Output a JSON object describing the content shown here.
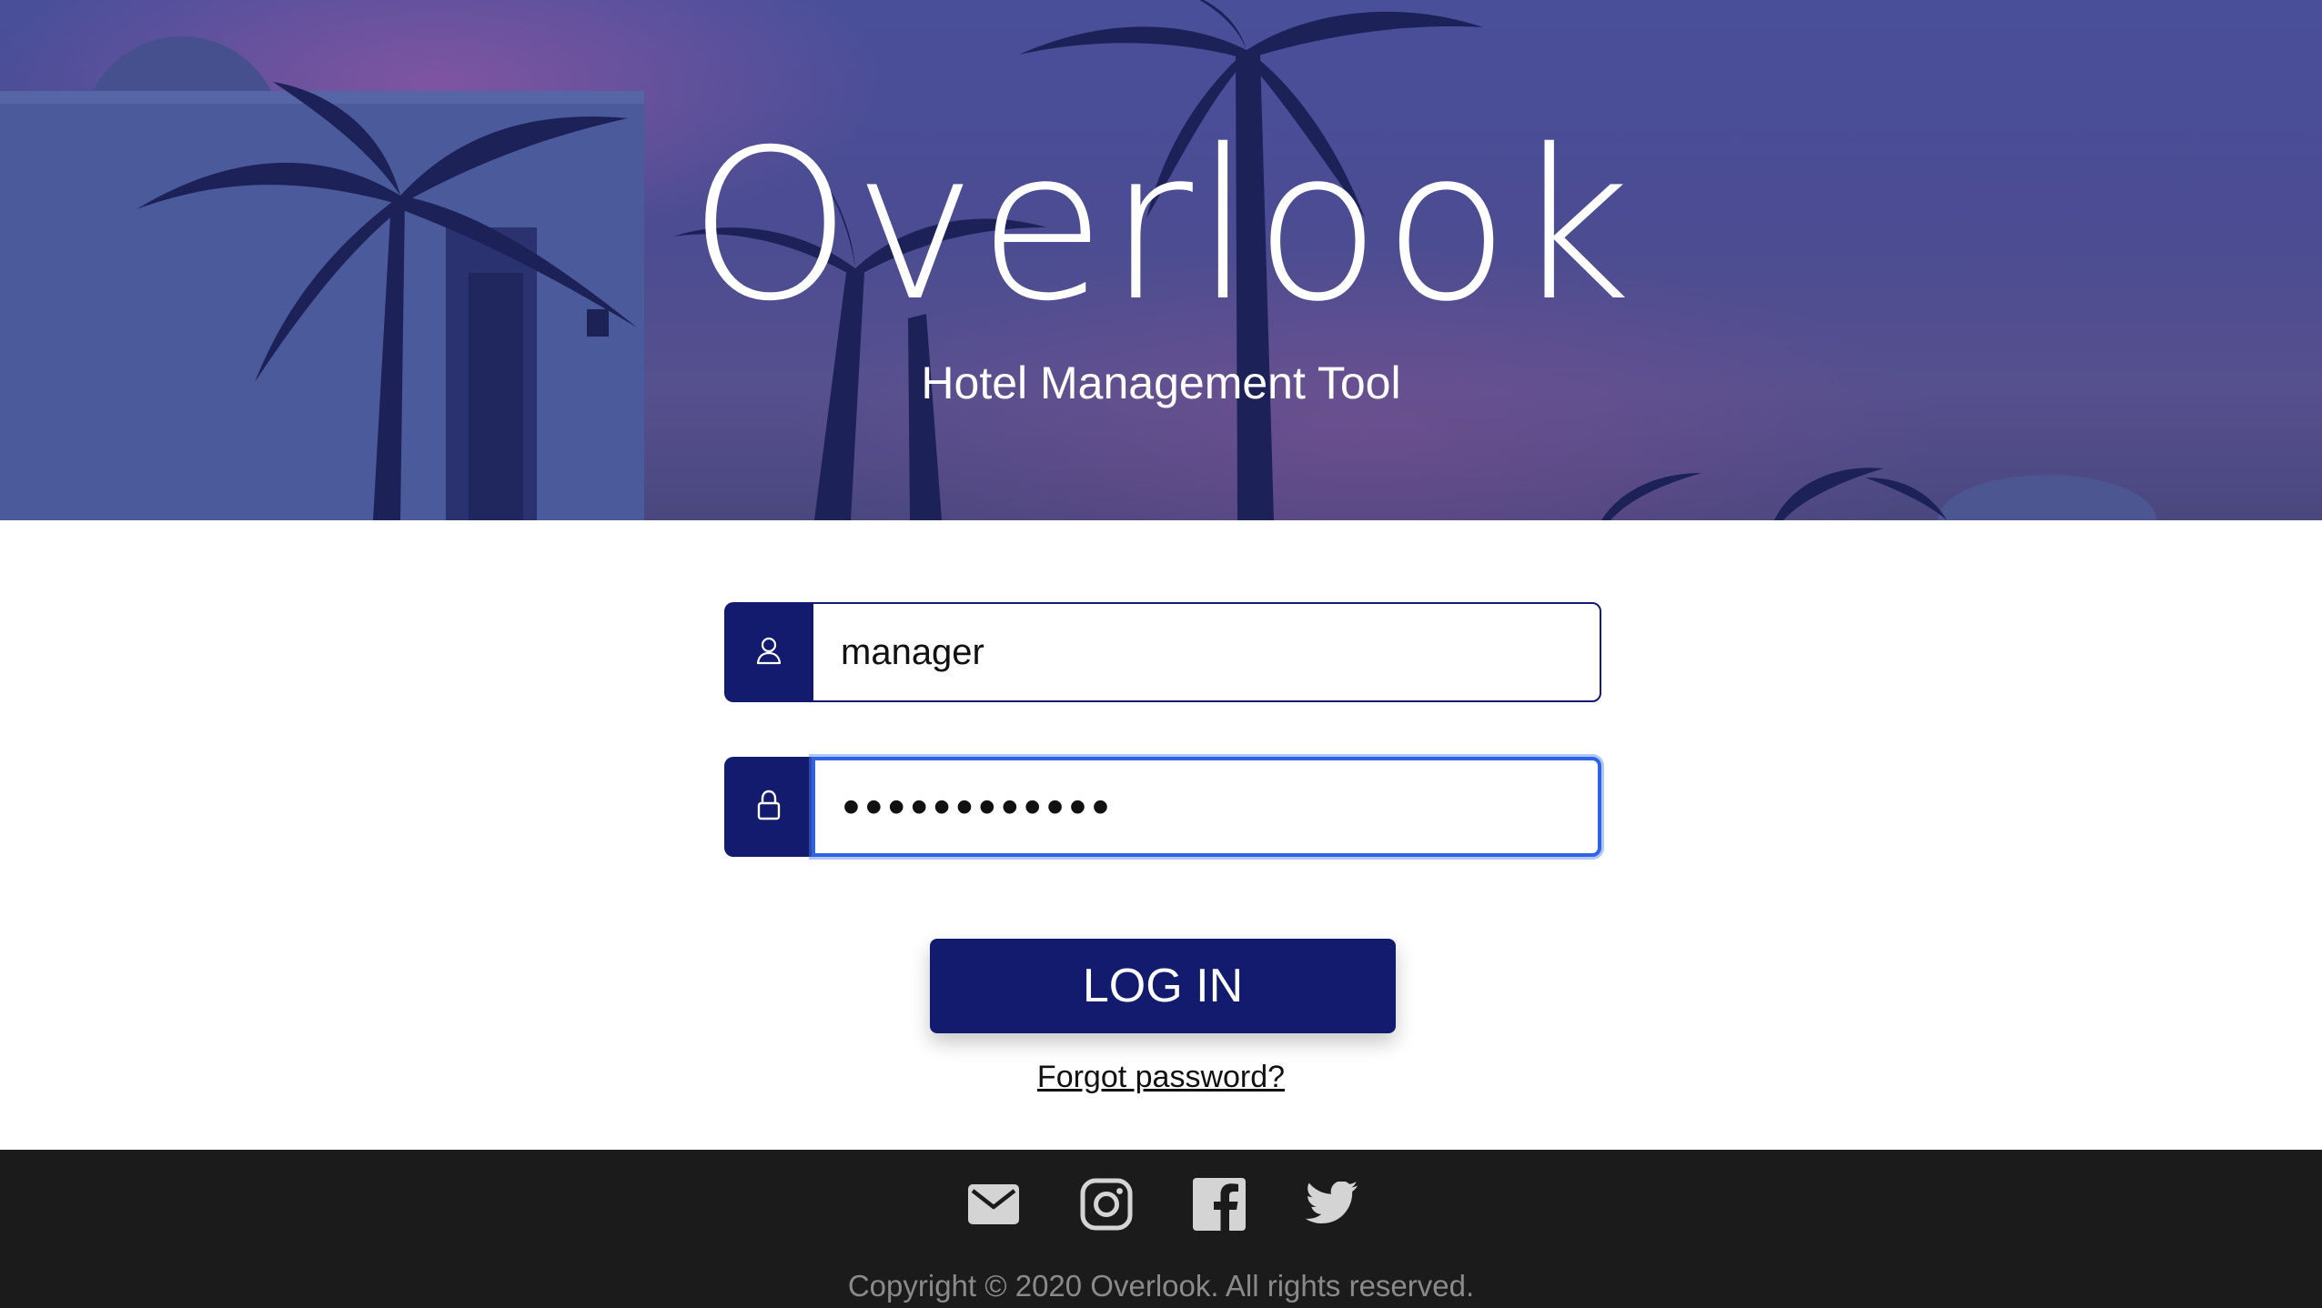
{
  "hero": {
    "title": "Overlook",
    "subtitle": "Hotel Management Tool"
  },
  "login": {
    "username": {
      "icon": "user-icon",
      "value": "manager"
    },
    "password": {
      "icon": "lock-icon",
      "value": "overlook2020"
    },
    "button_label": "LOG IN",
    "forgot_link": "Forgot password?"
  },
  "footer": {
    "social_icons": [
      "mail-icon",
      "instagram-icon",
      "facebook-icon",
      "twitter-icon"
    ],
    "copyright": "Copyright © 2020 Overlook. All rights reserved."
  },
  "colors": {
    "brand_navy": "#131b6e",
    "focus_ring": "#2f63e6",
    "footer_bg": "#1b1b1b",
    "footer_icon": "#d4d4d4",
    "footer_text": "#8a8a8a"
  }
}
